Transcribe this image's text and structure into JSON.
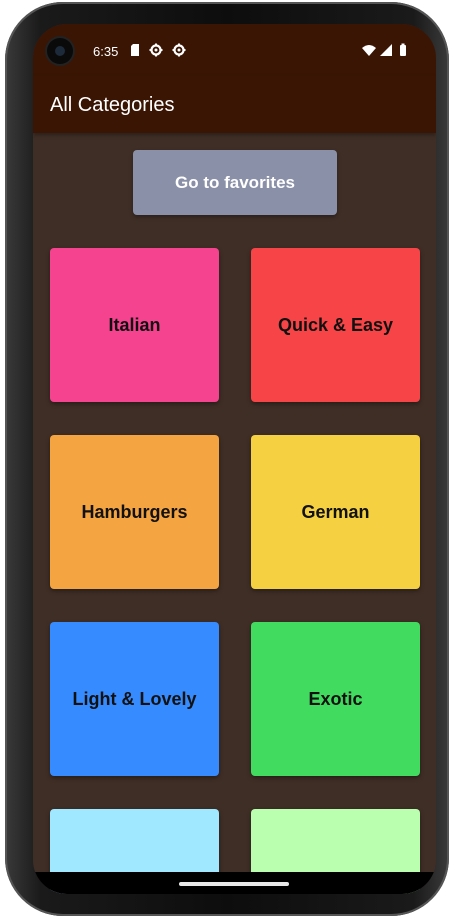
{
  "status_bar": {
    "time": "6:35",
    "icons": [
      "sim-card-icon",
      "settings-gear-icon",
      "settings-gear-icon",
      "wifi-icon",
      "cellular-signal-icon",
      "battery-icon"
    ]
  },
  "app_bar": {
    "title": "All Categories"
  },
  "favorites_button": {
    "label": "Go to favorites"
  },
  "categories": [
    {
      "label": "Italian",
      "color": "#f54390"
    },
    {
      "label": "Quick & Easy",
      "color": "#f64447"
    },
    {
      "label": "Hamburgers",
      "color": "#f5a442"
    },
    {
      "label": "German",
      "color": "#f5d142"
    },
    {
      "label": "Light & Lovely",
      "color": "#368bff"
    },
    {
      "label": "Exotic",
      "color": "#41db5f"
    },
    {
      "label": "",
      "color": "#9fe8ff"
    },
    {
      "label": "",
      "color": "#baffb0"
    }
  ],
  "colors": {
    "app_bar": "#3a1504",
    "background": "#3f2e26",
    "button": "#8a90a8"
  }
}
